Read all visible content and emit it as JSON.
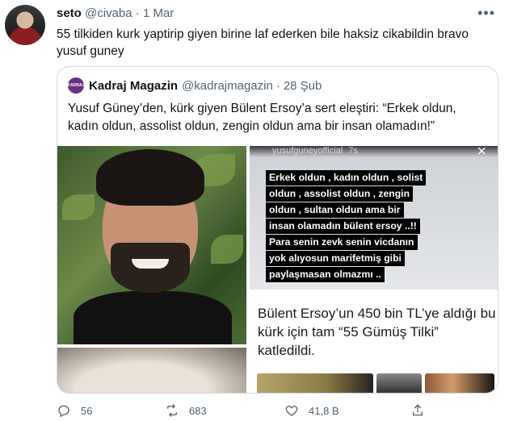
{
  "tweet": {
    "author_name": "seto",
    "author_handle": "@civaba",
    "separator": "·",
    "date": "1 Mar",
    "more_icon": "more-icon",
    "text": "55 tilkiden kurk yaptirip giyen birine laf ederken bile haksiz cikabildin bravo yusuf guney"
  },
  "quote": {
    "logo_text": "KADRAJ",
    "author_name": "Kadraj Magazin",
    "author_handle": "@kadrajmagazin",
    "separator": "·",
    "date": "28 Şub",
    "text": "Yusuf Güney’den, kürk giyen Bülent Ersoy’a sert eleştiri: “Erkek oldun, kadın oldun, assolist oldun, zengin oldun ama bir insan olamadın!”",
    "story_user": "yusufguneyofficial",
    "story_time": "7s",
    "story_close": "×",
    "story_lines": [
      "Erkek oldun , kadın oldun , solist",
      "oldun , assolist oldun , zengin",
      "oldun , sultan oldun ama bir",
      "insan olamadın  bülent ersoy ..!!",
      "Para senin zevk senin vicdanın",
      "yok alıyosun marifetmiş gibi",
      "paylaşmasan olmazmı .."
    ],
    "caption": "Bülent Ersoy’un 450 bin TL’ye aldığı bu kürk için tam “55 Gümüş Tilki” katledildi."
  },
  "actions": {
    "reply_count": "56",
    "retweet_count": "683",
    "like_count": "41,8 B",
    "share_icon": "share-icon"
  },
  "colors": {
    "text": "#0f1419",
    "secondary": "#536471",
    "border": "#cfd9de",
    "kadraj_brand": "#6b2f86"
  }
}
